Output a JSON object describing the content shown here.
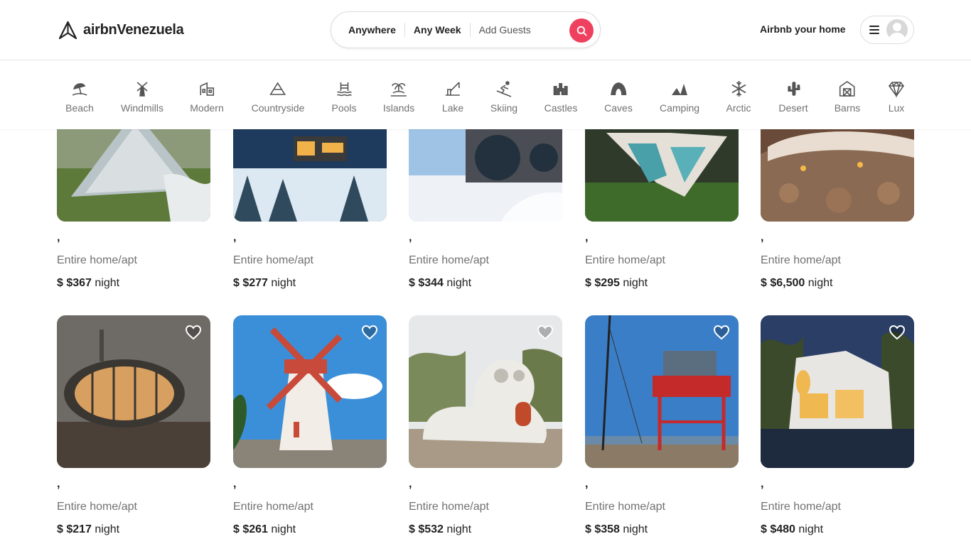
{
  "header": {
    "logo_text": "airbnVenezuela",
    "search": {
      "location": "Anywhere",
      "dates": "Any Week",
      "guests": "Add Guests"
    },
    "host_link": "Airbnb your home"
  },
  "categories": [
    {
      "label": "Beach",
      "icon": "beach-icon"
    },
    {
      "label": "Windmills",
      "icon": "windmill-icon"
    },
    {
      "label": "Modern",
      "icon": "modern-house-icon"
    },
    {
      "label": "Countryside",
      "icon": "countryside-icon"
    },
    {
      "label": "Pools",
      "icon": "pool-icon"
    },
    {
      "label": "Islands",
      "icon": "island-icon"
    },
    {
      "label": "Lake",
      "icon": "lake-icon"
    },
    {
      "label": "Skiing",
      "icon": "skiing-icon"
    },
    {
      "label": "Castles",
      "icon": "castle-icon"
    },
    {
      "label": "Caves",
      "icon": "cave-icon"
    },
    {
      "label": "Camping",
      "icon": "camping-icon"
    },
    {
      "label": "Arctic",
      "icon": "snowflake-icon"
    },
    {
      "label": "Desert",
      "icon": "cactus-icon"
    },
    {
      "label": "Barns",
      "icon": "barn-icon"
    },
    {
      "label": "Lux",
      "icon": "diamond-icon"
    }
  ],
  "listings": [
    {
      "title": ",",
      "type": "Entire home/apt",
      "currency": "$",
      "price": "$367",
      "unit": "night"
    },
    {
      "title": ",",
      "type": "Entire home/apt",
      "currency": "$",
      "price": "$277",
      "unit": "night"
    },
    {
      "title": ",",
      "type": "Entire home/apt",
      "currency": "$",
      "price": "$344",
      "unit": "night"
    },
    {
      "title": ",",
      "type": "Entire home/apt",
      "currency": "$",
      "price": "$295",
      "unit": "night"
    },
    {
      "title": ",",
      "type": "Entire home/apt",
      "currency": "$",
      "price": "$6,500",
      "unit": "night"
    },
    {
      "title": ",",
      "type": "Entire home/apt",
      "currency": "$",
      "price": "$217",
      "unit": "night"
    },
    {
      "title": ",",
      "type": "Entire home/apt",
      "currency": "$",
      "price": "$261",
      "unit": "night"
    },
    {
      "title": ",",
      "type": "Entire home/apt",
      "currency": "$",
      "price": "$532",
      "unit": "night"
    },
    {
      "title": ",",
      "type": "Entire home/apt",
      "currency": "$",
      "price": "$358",
      "unit": "night"
    },
    {
      "title": ",",
      "type": "Entire home/apt",
      "currency": "$",
      "price": "$480",
      "unit": "night"
    }
  ],
  "colors": {
    "brand": "#f0405f",
    "text": "#222222",
    "muted": "#717171"
  }
}
